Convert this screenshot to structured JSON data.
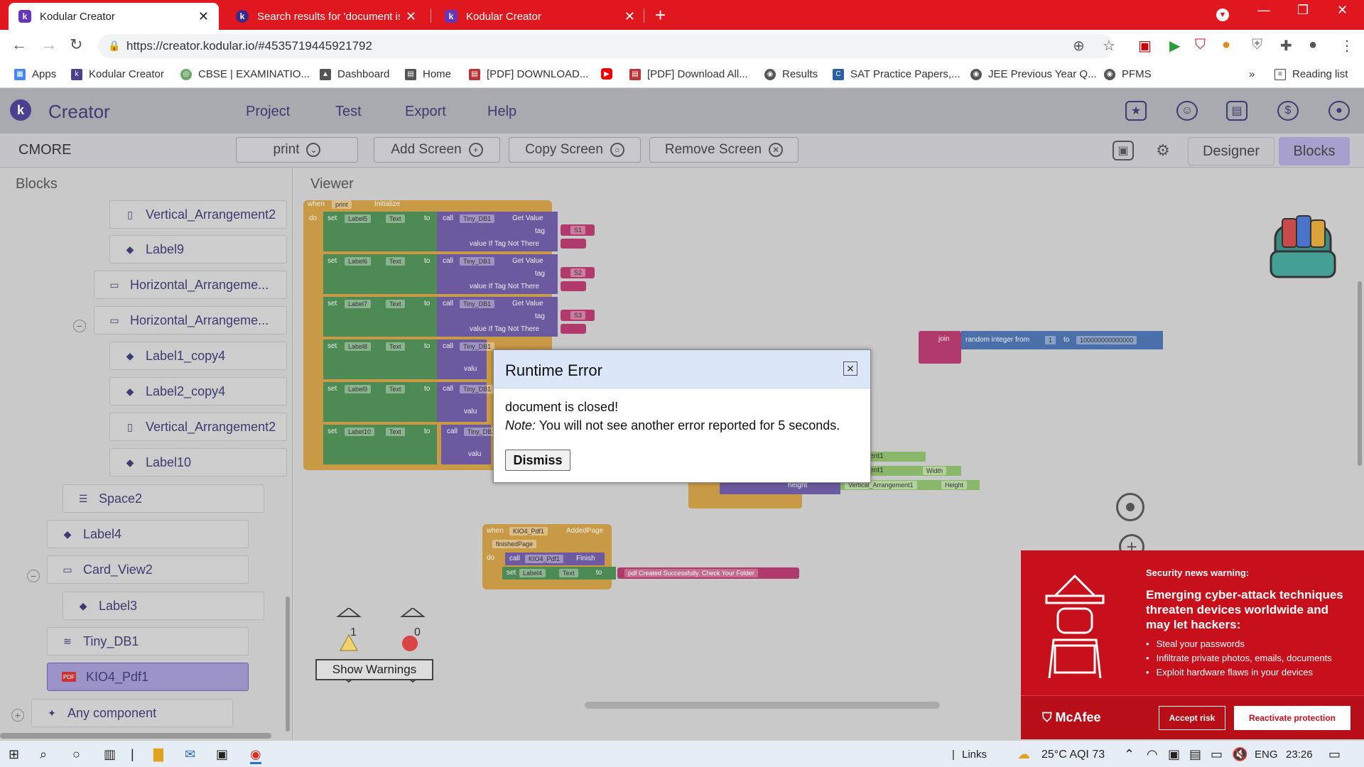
{
  "browser": {
    "tabs": [
      {
        "title": "Kodular Creator",
        "active": true
      },
      {
        "title": "Search results for 'document is cl",
        "active": false
      },
      {
        "title": "Kodular Creator",
        "active": false
      }
    ],
    "url": "https://creator.kodular.io/#4535719445921792",
    "bookmarks": [
      "Apps",
      "Kodular Creator",
      "CBSE | EXAMINATIO...",
      "Dashboard",
      "Home",
      "[PDF] DOWNLOAD...",
      "[PDF] Download All...",
      "Results",
      "SAT Practice Papers,...",
      "JEE Previous Year Q...",
      "PFMS"
    ],
    "bookmarks_more": "»",
    "reading_list": "Reading list"
  },
  "app": {
    "brand": "Creator",
    "menu": [
      "Project",
      "Test",
      "Export",
      "Help"
    ],
    "project_name": "CMORE",
    "screen_select": "print",
    "add_screen": "Add Screen",
    "copy_screen": "Copy Screen",
    "remove_screen": "Remove Screen",
    "designer": "Designer",
    "blocks": "Blocks"
  },
  "blocks_panel": {
    "title": "Blocks",
    "items": [
      {
        "label": "Vertical_Arrangement2",
        "icon": "vertical-arrangement-icon"
      },
      {
        "label": "Label9",
        "icon": "label-icon"
      },
      {
        "label": "Horizontal_Arrangeme...",
        "icon": "horizontal-arrangement-icon"
      },
      {
        "label": "Horizontal_Arrangeme...",
        "icon": "horizontal-arrangement-icon"
      },
      {
        "label": "Label1_copy4",
        "icon": "label-icon"
      },
      {
        "label": "Label2_copy4",
        "icon": "label-icon"
      },
      {
        "label": "Vertical_Arrangement2",
        "icon": "vertical-arrangement-icon"
      },
      {
        "label": "Label10",
        "icon": "label-icon"
      },
      {
        "label": "Space2",
        "icon": "space-icon"
      },
      {
        "label": "Label4",
        "icon": "label-icon"
      },
      {
        "label": "Card_View2",
        "icon": "card-view-icon"
      },
      {
        "label": "Label3",
        "icon": "label-icon"
      },
      {
        "label": "Tiny_DB1",
        "icon": "database-icon"
      },
      {
        "label": "KIO4_Pdf1",
        "icon": "pdf-icon"
      },
      {
        "label": "Any component",
        "icon": "sparkle-icon"
      }
    ]
  },
  "viewer": {
    "title": "Viewer",
    "event_when": "when",
    "event_component": "print",
    "event_name": "Initialize",
    "do": "do",
    "set_rows": [
      {
        "label": "Label5",
        "tag": "S1"
      },
      {
        "label": "Label6",
        "tag": "S2"
      },
      {
        "label": "Label7",
        "tag": "S3"
      },
      {
        "label": "Label8",
        "tag": ""
      },
      {
        "label": "Label9",
        "tag": ""
      },
      {
        "label": "Label10",
        "tag": ""
      }
    ],
    "w_set": "set",
    "w_text": "Text",
    "w_to": "to",
    "w_call": "call",
    "w_tinydb": "Tiny_DB1",
    "w_getvalue": "Get Value",
    "w_tag": "tag",
    "w_valueiftag": "value If Tag Not There",
    "w_value_trunc": "valu",
    "join_block": {
      "join": "join",
      "random": "random integer from",
      "from": "1",
      "to": "to",
      "to_value": "100000000000000"
    },
    "arr_block": {
      "a1": "rrangement1",
      "a2": "rrangement1",
      "width": "Width",
      "height_label": "height",
      "va": "Vertical_Arrangement1",
      "height": "Height"
    },
    "pdf_event": {
      "when": "when",
      "component": "KIO4_Pdf1",
      "event": "AddedPage",
      "param": "finishedPage",
      "do": "do",
      "call": "call",
      "call_comp": "KIO4_Pdf1",
      "call_method": "Finish",
      "set": "set",
      "set_comp": "Label4",
      "set_prop": "Text",
      "to": "to",
      "text": "pdf Created Successfully.  Check Your Folder"
    },
    "warnings_count": "1",
    "errors_count": "0",
    "show_warnings": "Show Warnings"
  },
  "dialog": {
    "title": "Runtime Error",
    "message": "document is closed!",
    "note_label": "Note:",
    "note_text": " You will not see another error reported for 5 seconds.",
    "dismiss": "Dismiss"
  },
  "mcafee": {
    "warning": "Security news warning:",
    "headline": "Emerging cyber-attack techniques threaten devices worldwide and may let hackers:",
    "bullets": [
      "Steal your passwords",
      "Infiltrate private photos, emails, documents",
      "Exploit hardware flaws in your devices"
    ],
    "logo": "McAfee",
    "accept": "Accept risk",
    "reactivate": "Reactivate protection"
  },
  "taskbar": {
    "links": "Links",
    "weather": "25°C  AQI 73",
    "lang": "ENG",
    "time": "23:26"
  },
  "colors": {
    "chrome_red": "#e0171f",
    "kodular_purple": "#4b3f8f",
    "mcafee_red": "#c8101c"
  }
}
